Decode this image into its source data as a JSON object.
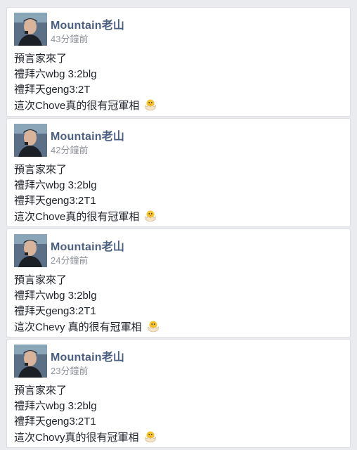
{
  "posts": [
    {
      "author": "Mountain老山",
      "time": "43分鐘前",
      "lines": [
        "預言家來了",
        "禮拜六wbg 3:2blg",
        "禮拜天geng3:2T",
        "這次Chove真的很有冠軍相"
      ],
      "emoji_icon": "hatching-chick-icon"
    },
    {
      "author": "Mountain老山",
      "time": "42分鐘前",
      "lines": [
        "預言家來了",
        "禮拜六wbg 3:2blg",
        "禮拜天geng3:2T1",
        "這次Chove真的很有冠軍相"
      ],
      "emoji_icon": "hatching-chick-icon"
    },
    {
      "author": "Mountain老山",
      "time": "24分鐘前",
      "lines": [
        "預言家來了",
        "禮拜六wbg 3:2blg",
        "禮拜天geng3:2T1",
        "這次Chevy 真的很有冠軍相"
      ],
      "emoji_icon": "hatching-chick-icon"
    },
    {
      "author": "Mountain老山",
      "time": "23分鐘前",
      "lines": [
        "預言家來了",
        "禮拜六wbg 3:2blg",
        "禮拜天geng3:2T1",
        "這次Chovy真的很有冠軍相"
      ],
      "emoji_icon": "hatching-chick-icon"
    }
  ],
  "colors": {
    "author": "#4b5f82",
    "time": "#90949c",
    "text": "#1d2129",
    "background": "#e9ebee",
    "card": "#ffffff"
  }
}
